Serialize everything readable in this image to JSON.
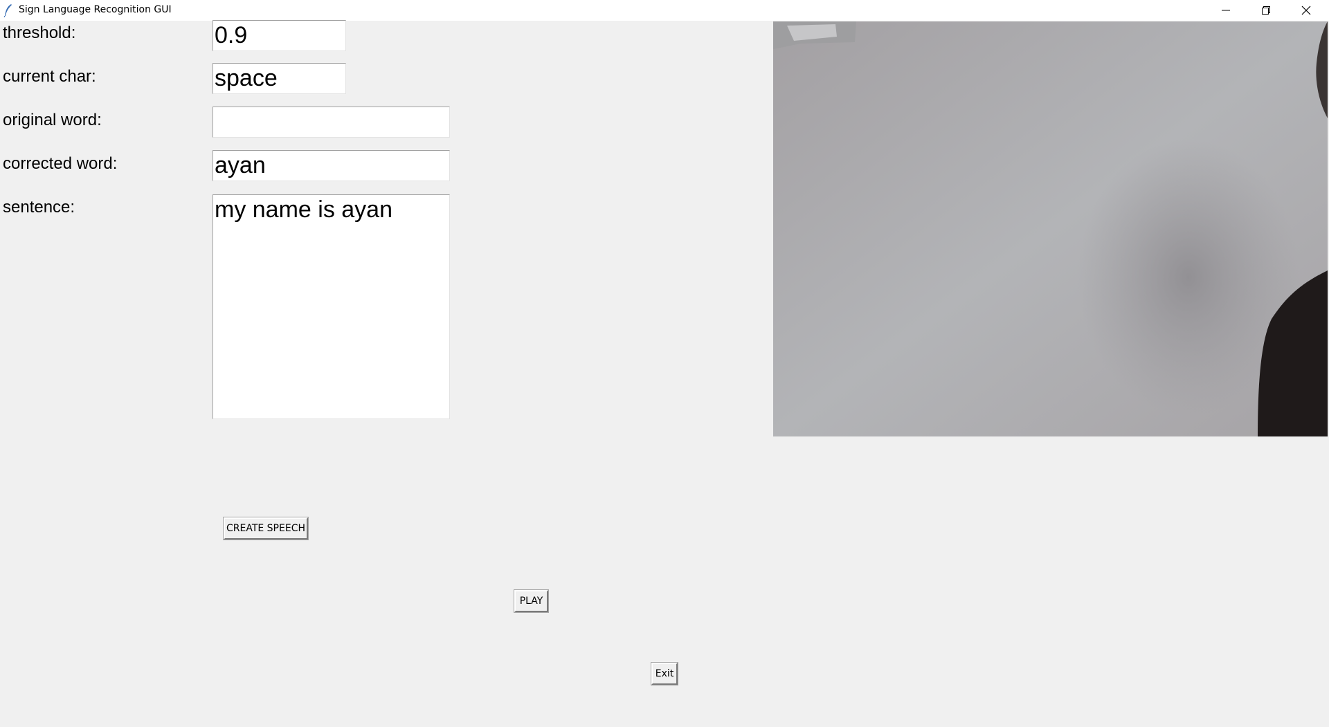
{
  "window": {
    "title": "Sign Language Recognition GUI",
    "controls": {
      "minimize_icon": "minimize-icon",
      "maximize_icon": "restore-icon",
      "close_icon": "close-icon"
    }
  },
  "form": {
    "threshold": {
      "label": "threshold:",
      "value": "0.9"
    },
    "current_char": {
      "label": "current char:",
      "value": "space"
    },
    "original_word": {
      "label": "original word:",
      "value": ""
    },
    "corrected_word": {
      "label": "corrected word:",
      "value": "ayan"
    },
    "sentence": {
      "label": "sentence:",
      "value": "my name is ayan"
    }
  },
  "buttons": {
    "create_speech": "CREATE SPEECH",
    "play": "PLAY",
    "exit": "Exit"
  },
  "colors": {
    "background": "#f0f0f0",
    "field_background": "#ffffff"
  }
}
